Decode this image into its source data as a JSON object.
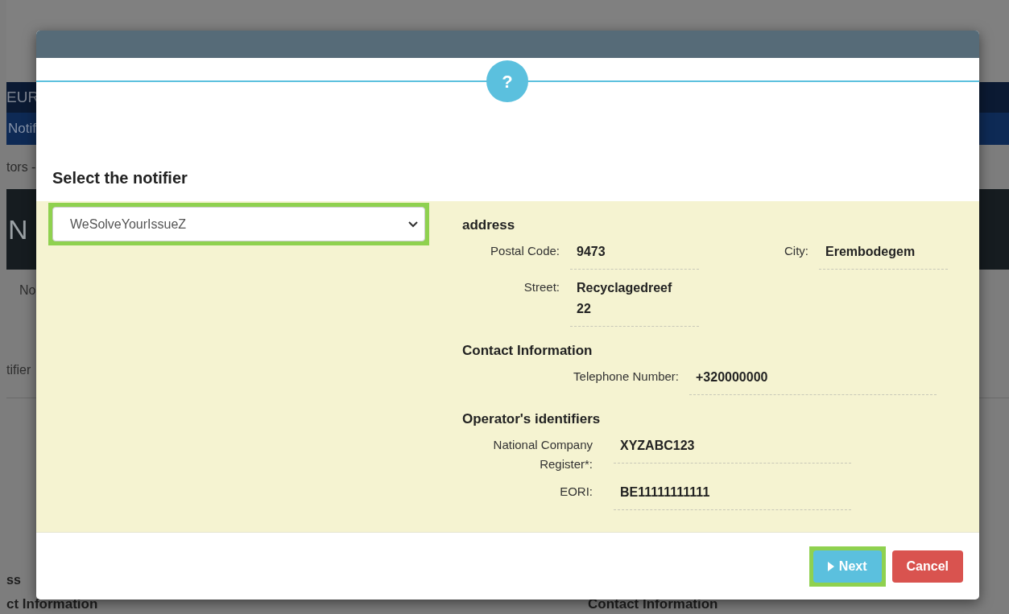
{
  "background_page": {
    "header_text": "EUR",
    "nav_tab": "Notif",
    "breadcrumb": "tors -",
    "page_title": "N",
    "tab_label": "No",
    "field_label": "tifier",
    "section_label": "ss",
    "left_section_heading": "ct Information",
    "right_section_heading": "Contact Information"
  },
  "dialog": {
    "icon": "?",
    "title": "Select the notifier",
    "select": {
      "value": "WeSolveYourIssueZ",
      "highlighted": true
    },
    "sections": [
      {
        "kind": "address",
        "heading": "address",
        "rows": [
          [
            {
              "label": "Postal Code:",
              "value": "9473"
            },
            {
              "label": "City:",
              "value": "Erembodegem"
            }
          ],
          [
            {
              "label": "Street:",
              "value": "Recyclagedreef 22"
            }
          ]
        ]
      },
      {
        "kind": "contact",
        "heading": "Contact Information",
        "rows": [
          [
            {
              "label": "Telephone Number:",
              "value": "+320000000"
            }
          ]
        ]
      },
      {
        "kind": "identifiers",
        "heading": "Operator's identifiers",
        "rows": [
          [
            {
              "label": "National Company Register*:",
              "value": "XYZABC123"
            }
          ],
          [
            {
              "label": "EORI:",
              "value": "BE11111111111"
            }
          ]
        ]
      }
    ],
    "buttons": [
      {
        "kind": "primary",
        "label": "Next",
        "highlighted": true
      },
      {
        "kind": "danger",
        "label": "Cancel",
        "highlighted": false
      }
    ]
  }
}
